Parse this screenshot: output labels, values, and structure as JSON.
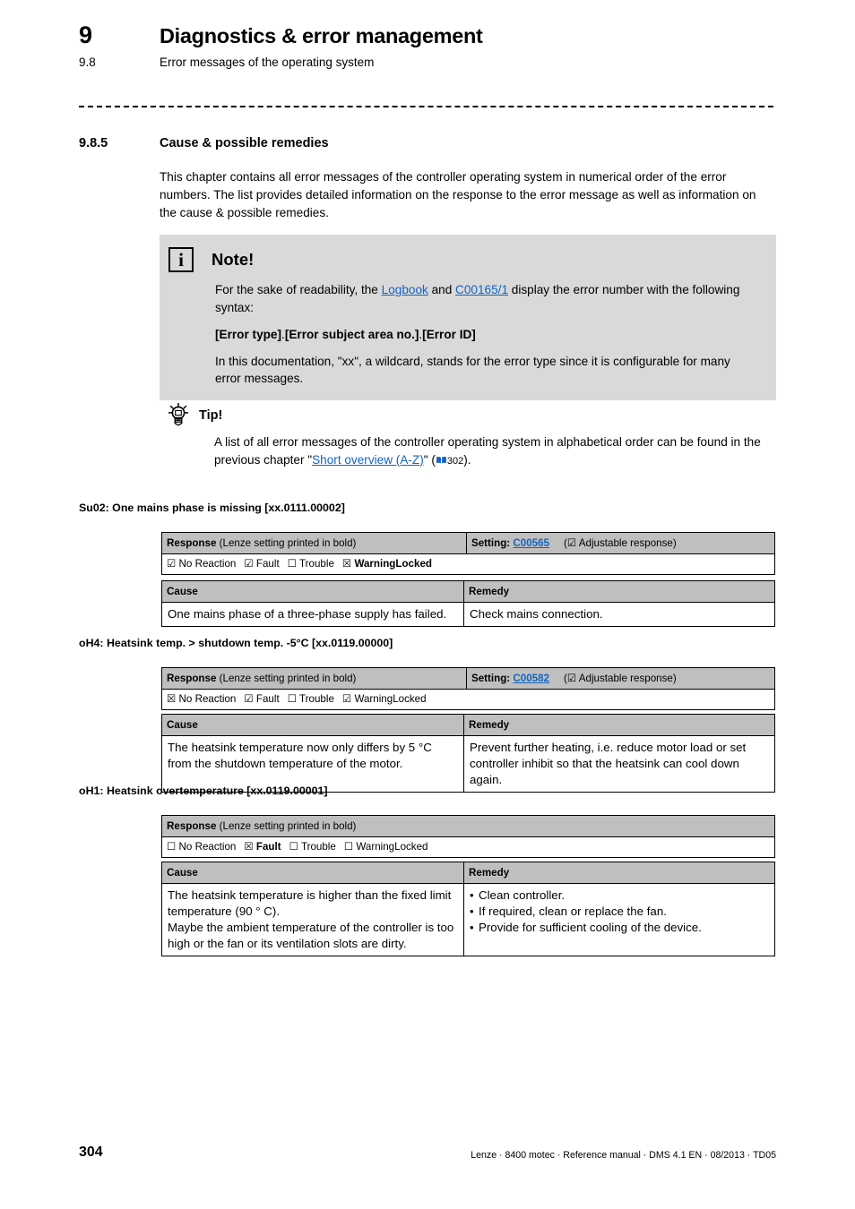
{
  "header": {
    "chapter_number": "9",
    "chapter_title": "Diagnostics & error management",
    "section_number": "9.8",
    "section_title": "Error messages of the operating system"
  },
  "section": {
    "number": "9.8.5",
    "title": "Cause & possible remedies",
    "intro": "This chapter contains all error messages of the controller operating system in numerical order of the error numbers. The list provides detailed information on the response to the error message as well as information on the cause & possible remedies."
  },
  "note": {
    "icon": "info-icon",
    "title": "Note!",
    "para1_before": "For the sake of readability, the ",
    "link1": "Logbook",
    "para1_mid": " and ",
    "link2": "C00165/1",
    "para1_after": " display the error number with the following syntax:",
    "syntax_1": "[Error type]",
    "syntax_sep": ".",
    "syntax_2": "[Error subject area no.]",
    "syntax_3": "[Error ID]",
    "para2": "In this documentation, \"xx\", a wildcard, stands for the error type since it is configurable for many error messages."
  },
  "tip": {
    "icon": "lightbulb-icon",
    "title": "Tip!",
    "text_before": "A list of all error messages of the controller operating system in alphabetical order can be found in the previous chapter \"",
    "link": "Short overview (A-Z)",
    "text_after": "\" (",
    "book_icon": "book-icon",
    "page_ref": "302",
    "text_end": ").",
    "link_color": "#1565c0"
  },
  "errors": [
    {
      "title": "Su02: One mains phase is missing [xx.0111.00002]",
      "response_header": "Response",
      "response_header_note": "(Lenze setting printed in bold)",
      "setting_label": "Setting:",
      "setting_link": "C00565",
      "adjustable_box": "☑",
      "adjustable_text": "Adjustable response",
      "has_setting": true,
      "options": [
        {
          "box": "☑",
          "label": "No Reaction",
          "bold": false
        },
        {
          "box": "☑",
          "label": "Fault",
          "bold": false
        },
        {
          "box": "☐",
          "label": "Trouble",
          "bold": false
        },
        {
          "box": "☒",
          "label": "WarningLocked",
          "bold": true
        }
      ],
      "cause_header": "Cause",
      "remedy_header": "Remedy",
      "cause": [
        "One mains phase of a three-phase supply has failed."
      ],
      "remedy": [
        "Check mains connection."
      ],
      "remedy_bulleted": false
    },
    {
      "title": "oH4: Heatsink temp. > shutdown temp. -5°C [xx.0119.00000]",
      "response_header": "Response",
      "response_header_note": "(Lenze setting printed in bold)",
      "setting_label": "Setting:",
      "setting_link": "C00582",
      "adjustable_box": "☑",
      "adjustable_text": "Adjustable response",
      "has_setting": true,
      "options": [
        {
          "box": "☒",
          "label": "No Reaction",
          "bold": false
        },
        {
          "box": "☑",
          "label": "Fault",
          "bold": false
        },
        {
          "box": "☐",
          "label": "Trouble",
          "bold": false
        },
        {
          "box": "☑",
          "label": "WarningLocked",
          "bold": false
        }
      ],
      "cause_header": "Cause",
      "remedy_header": "Remedy",
      "cause": [
        "The heatsink temperature now only differs by 5 °C from the shutdown temperature of the motor."
      ],
      "remedy": [
        "Prevent further heating, i.e. reduce motor load or set controller inhibit so that the heatsink can cool down again."
      ],
      "remedy_bulleted": false
    },
    {
      "title": "oH1: Heatsink overtemperature [xx.0119.00001]",
      "response_header": "Response",
      "response_header_note": "(Lenze setting printed in bold)",
      "setting_label": "",
      "setting_link": "",
      "adjustable_box": "",
      "adjustable_text": "",
      "has_setting": false,
      "options": [
        {
          "box": "☐",
          "label": "No Reaction",
          "bold": false
        },
        {
          "box": "☒",
          "label": "Fault",
          "bold": true
        },
        {
          "box": "☐",
          "label": "Trouble",
          "bold": false
        },
        {
          "box": "☐",
          "label": "WarningLocked",
          "bold": false
        }
      ],
      "cause_header": "Cause",
      "remedy_header": "Remedy",
      "cause": [
        "The heatsink temperature is higher than the fixed limit temperature (90 ° C).",
        "Maybe the ambient temperature of the controller is too high or the fan or its ventilation slots are dirty."
      ],
      "remedy": [
        "Clean controller.",
        "If required, clean or replace the fan.",
        "Provide for sufficient cooling of the device."
      ],
      "remedy_bulleted": true
    }
  ],
  "footer": {
    "page_number": "304",
    "meta": "Lenze · 8400 motec · Reference manual · DMS 4.1 EN · 08/2013 · TD05"
  }
}
